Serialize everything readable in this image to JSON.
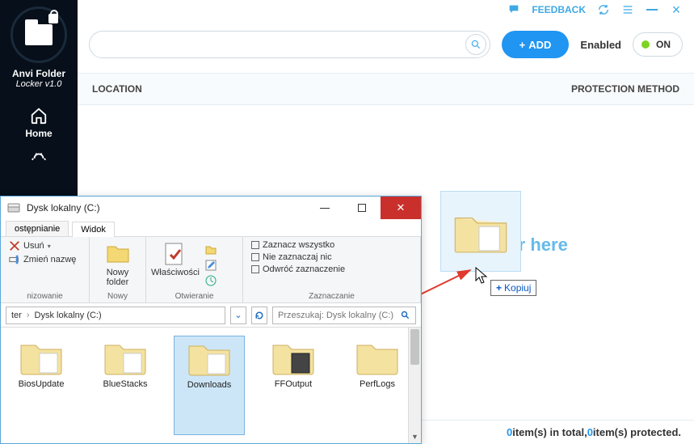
{
  "app": {
    "name": "Anvi Folder",
    "version_line": "Locker v1.0",
    "feedback": "FEEDBACK"
  },
  "nav": {
    "home": "Home"
  },
  "toolbar": {
    "add": "ADD",
    "enabled": "Enabled",
    "toggle": "ON"
  },
  "columns": {
    "location": "LOCATION",
    "protection": "PROTECTION METHOD"
  },
  "drop_hint": "der here",
  "status": {
    "n_total": "0",
    "txt_total": " item(s) in total, ",
    "n_prot": "0",
    "txt_prot": " item(s) protected."
  },
  "copy_tip": "Kopiuj",
  "explorer": {
    "title": "Dysk lokalny (C:)",
    "tabs": {
      "share": "ostępnianie",
      "view": "Widok"
    },
    "ribbon": {
      "delete": "Usuń",
      "rename": "Zmień nazwę",
      "org_group": "nizowanie",
      "new_folder": "Nowy\nfolder",
      "new_group": "Nowy",
      "properties": "Właściwości",
      "open_group": "Otwieranie",
      "select_all": "Zaznacz wszystko",
      "select_none": "Nie zaznaczaj nic",
      "invert": "Odwróć zaznaczenie",
      "select_group": "Zaznaczanie"
    },
    "path": {
      "sep1": "ter",
      "current": "Dysk lokalny (C:)",
      "search_placeholder": "Przeszukaj: Dysk lokalny (C:)"
    },
    "folders": [
      "BiosUpdate",
      "BlueStacks",
      "Downloads",
      "FFOutput",
      "PerfLogs"
    ]
  }
}
